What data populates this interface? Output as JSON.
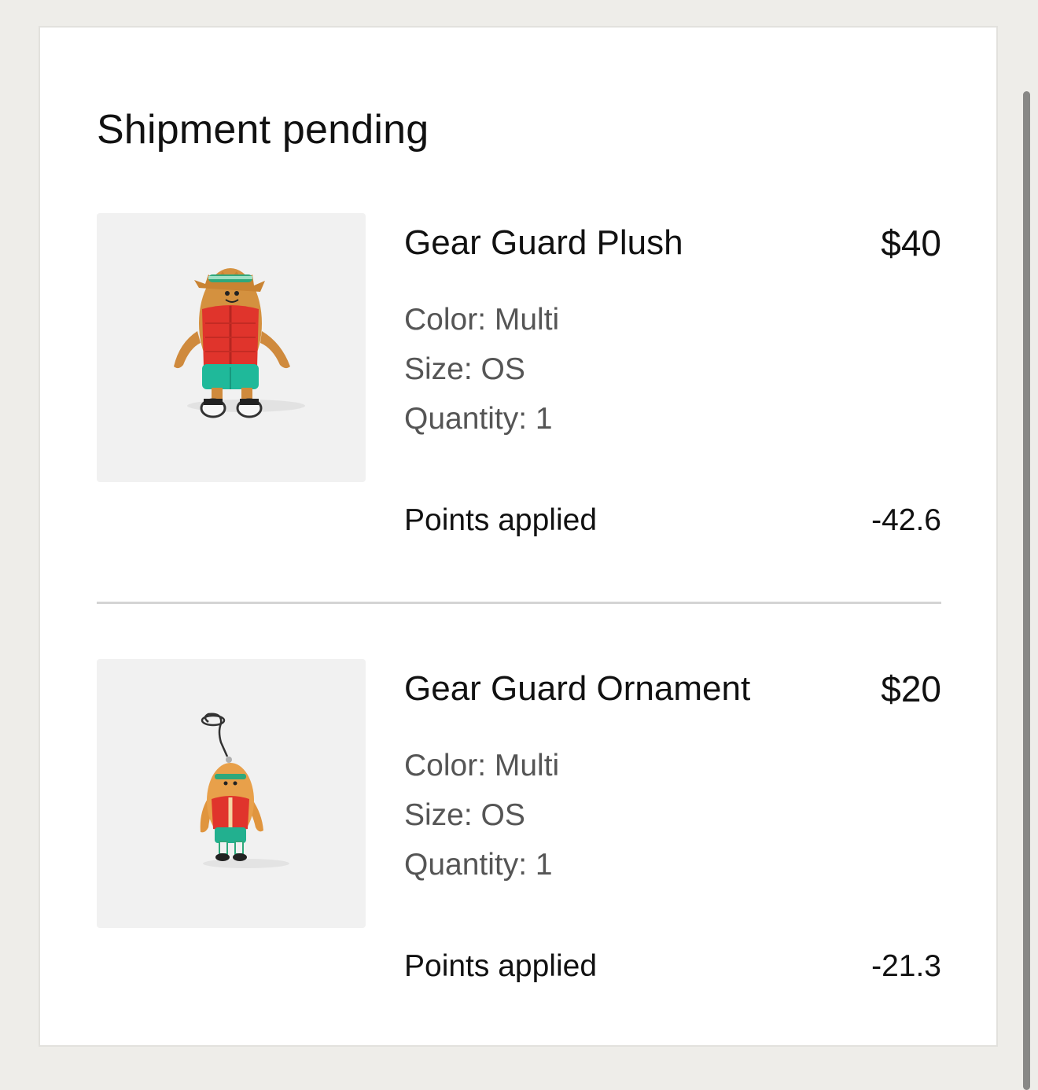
{
  "section": {
    "title": "Shipment pending"
  },
  "items": [
    {
      "name": "Gear Guard Plush",
      "price": "$40",
      "color": "Color: Multi",
      "size": "Size: OS",
      "quantity": "Quantity: 1",
      "points_label": "Points applied",
      "points_value": "-42.6",
      "image": "gear-guard-plush-image"
    },
    {
      "name": "Gear Guard Ornament",
      "price": "$20",
      "color": "Color: Multi",
      "size": "Size: OS",
      "quantity": "Quantity: 1",
      "points_label": "Points applied",
      "points_value": "-21.3",
      "image": "gear-guard-ornament-image"
    }
  ],
  "colors": {
    "page_background": "#eeede9",
    "card_background": "#ffffff",
    "thumbnail_background": "#f1f1f1",
    "primary_text": "#111111",
    "secondary_text": "#555555",
    "divider": "#d4d4d4"
  }
}
